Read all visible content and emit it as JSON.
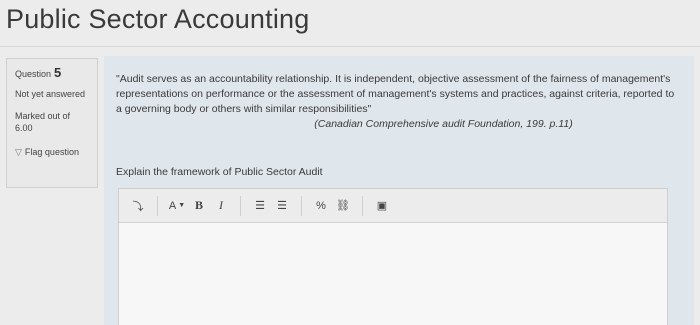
{
  "page": {
    "title": "Public Sector Accounting"
  },
  "question_info": {
    "label": "Question",
    "number": "5",
    "status": "Not yet answered",
    "marks": "Marked out of 6.00",
    "flag_label": "Flag question"
  },
  "question": {
    "quote": "\"Audit serves as an accountability relationship. It is independent, objective assessment of the fairness of management's representations on performance or the assessment of management's systems and practices, against criteria, reported to a governing body or others with similar responsibilities\"",
    "citation": "(Canadian Comprehensive audit Foundation, 199. p.11)",
    "prompt": "Explain the framework of Public Sector Audit"
  },
  "editor": {
    "toolbar": {
      "expand": "⤵",
      "font_color": "A",
      "bold": "B",
      "italic": "I",
      "bullet_list": "☰",
      "numbered_list": "☰",
      "link": "%",
      "unlink": "⛓",
      "image": "▣"
    },
    "content": ""
  }
}
